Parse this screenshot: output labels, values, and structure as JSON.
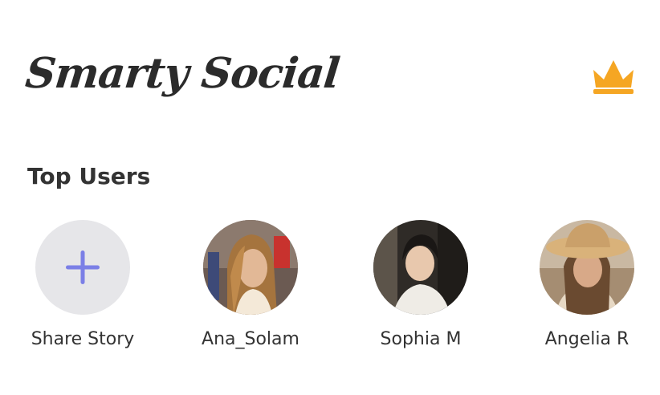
{
  "header": {
    "logo_text": "Smarty Social",
    "premium_icon": "crown-icon",
    "accent_color": "#F5A623"
  },
  "section": {
    "title": "Top Users"
  },
  "stories": [
    {
      "label": "Share Story",
      "icon": "plus-icon",
      "icon_color": "#7B7FE6"
    },
    {
      "label": "Ana_Solam",
      "avatar": "avatar-photo"
    },
    {
      "label": "Sophia M",
      "avatar": "avatar-photo"
    },
    {
      "label": "Angelia R",
      "avatar": "avatar-photo"
    }
  ]
}
